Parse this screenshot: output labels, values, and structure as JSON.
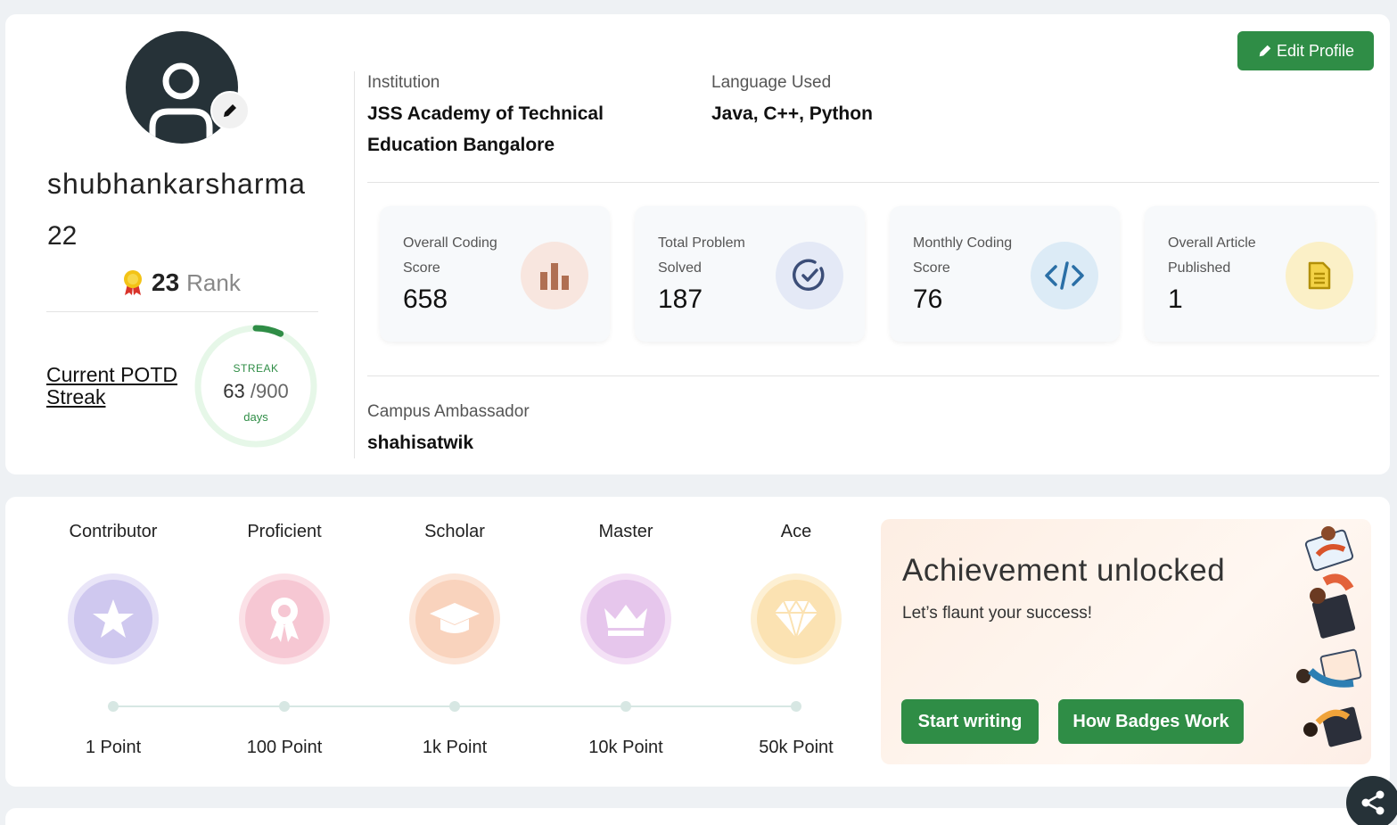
{
  "profile": {
    "username": "shubhankarsharma",
    "age": "22",
    "rank_number": "23",
    "rank_label": "Rank",
    "potd_link": "Current POTD Streak",
    "streak": {
      "label": "STREAK",
      "current": "63",
      "total": "/900",
      "unit": "days",
      "progress_fraction": 0.07
    }
  },
  "details": {
    "institution_label": "Institution",
    "institution_value": "JSS Academy of Technical Education Bangalore",
    "language_label": "Language Used",
    "language_value": "Java, C++, Python",
    "ambassador_label": "Campus Ambassador",
    "ambassador_value": "shahisatwik",
    "edit_button": "Edit Profile"
  },
  "stats": [
    {
      "title": "Overall Coding Score",
      "value": "658",
      "icon": "bar-chart-icon"
    },
    {
      "title": "Total Problem Solved",
      "value": "187",
      "icon": "check-circle-icon"
    },
    {
      "title": "Monthly Coding Score",
      "value": "76",
      "icon": "code-icon"
    },
    {
      "title": "Overall Article Published",
      "value": "1",
      "icon": "document-icon"
    }
  ],
  "badges": [
    {
      "name": "Contributor",
      "points": "1 Point",
      "icon": "star-icon",
      "color": "#cfc8ef"
    },
    {
      "name": "Proficient",
      "points": "100 Point",
      "icon": "award-ribbon-icon",
      "color": "#f6c7d3"
    },
    {
      "name": "Scholar",
      "points": "1k Point",
      "icon": "graduation-cap-icon",
      "color": "#f9d3bd"
    },
    {
      "name": "Master",
      "points": "10k Point",
      "icon": "crown-icon",
      "color": "#e6c6ec"
    },
    {
      "name": "Ace",
      "points": "50k Point",
      "icon": "diamond-icon",
      "color": "#fbe2b2"
    }
  ],
  "achievement": {
    "title": "Achievement unlocked",
    "subtitle": "Let’s flaunt your success!",
    "start_button": "Start writing",
    "badges_button": "How Badges Work"
  },
  "colors": {
    "brand_green": "#2f8d46",
    "dark_avatar": "#263238"
  }
}
